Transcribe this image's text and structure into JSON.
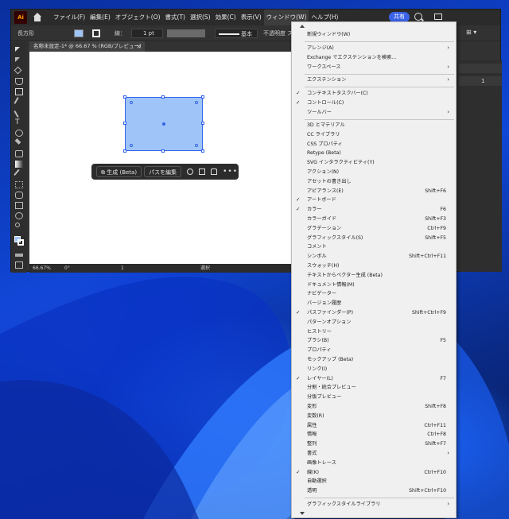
{
  "menubar": {
    "logo": "Ai",
    "items": [
      "ファイル(F)",
      "編集(E)",
      "オブジェクト(O)",
      "書式(T)",
      "選択(S)",
      "効果(C)",
      "表示(V)",
      "ウィンドウ(W)",
      "ヘルプ(H)"
    ],
    "active_item": "ウィンドウ(W)",
    "share_label": "共有"
  },
  "controlbar": {
    "object_type": "長方形",
    "stroke_label": "線：",
    "stroke_weight": "1 pt",
    "brush_label": "基本",
    "opacity_label": "不透明度 ス",
    "right_value": "1"
  },
  "document": {
    "tab_title": "名称未設定-1* @ 66.67 % (RGB/プレビュー)",
    "close_glyph": "×"
  },
  "context_bar": {
    "generate_label": "生成 (Beta)",
    "edit_path_label": "パスを編集",
    "more_glyph": "•••"
  },
  "statusbar": {
    "zoom": "66.67%",
    "rotation": "0°",
    "artboard": "1",
    "tool": "選択"
  },
  "colors": {
    "fill": "#9fc5f8",
    "selection": "#3563e8",
    "accent": "#3b63e6"
  },
  "window_menu": {
    "items": [
      {
        "label": "新規ウィンドウ(W)",
        "check": "",
        "shortcut": "",
        "submenu": false
      },
      {
        "label": "アレンジ(A)",
        "check": "",
        "shortcut": "",
        "submenu": true
      },
      {
        "label": "Exchange でエクステンションを検索...",
        "check": "",
        "shortcut": "",
        "submenu": false
      },
      {
        "label": "ワークスペース",
        "check": "",
        "shortcut": "",
        "submenu": true
      },
      {
        "label": "エクステンション",
        "check": "",
        "shortcut": "",
        "submenu": true
      },
      {
        "label": "コンテキストタスクバー(C)",
        "check": "✓",
        "shortcut": "",
        "submenu": false
      },
      {
        "label": "コントロール(C)",
        "check": "✓",
        "shortcut": "",
        "submenu": false
      },
      {
        "label": "ツールバー",
        "check": "",
        "shortcut": "",
        "submenu": true
      },
      {
        "label": "3D とマテリアル",
        "check": "",
        "shortcut": "",
        "submenu": false
      },
      {
        "label": "CC ライブラリ",
        "check": "",
        "shortcut": "",
        "submenu": false
      },
      {
        "label": "CSS プロパティ",
        "check": "",
        "shortcut": "",
        "submenu": false
      },
      {
        "label": "Retype (Beta)",
        "check": "",
        "shortcut": "",
        "submenu": false
      },
      {
        "label": "SVG インタラクティビティ(Y)",
        "check": "",
        "shortcut": "",
        "submenu": false
      },
      {
        "label": "アクション(N)",
        "check": "",
        "shortcut": "",
        "submenu": false
      },
      {
        "label": "アセットの書き出し",
        "check": "",
        "shortcut": "",
        "submenu": false
      },
      {
        "label": "アピアランス(E)",
        "check": "",
        "shortcut": "Shift+F6",
        "submenu": false
      },
      {
        "label": "アートボード",
        "check": "✓",
        "shortcut": "",
        "submenu": false
      },
      {
        "label": "カラー",
        "check": "✓",
        "shortcut": "F6",
        "submenu": false
      },
      {
        "label": "カラーガイド",
        "check": "",
        "shortcut": "Shift+F3",
        "submenu": false
      },
      {
        "label": "グラデーション",
        "check": "",
        "shortcut": "Ctrl+F9",
        "submenu": false
      },
      {
        "label": "グラフィックスタイル(S)",
        "check": "",
        "shortcut": "Shift+F5",
        "submenu": false
      },
      {
        "label": "コメント",
        "check": "",
        "shortcut": "",
        "submenu": false
      },
      {
        "label": "シンボル",
        "check": "",
        "shortcut": "Shift+Ctrl+F11",
        "submenu": false
      },
      {
        "label": "スウォッチ(H)",
        "check": "",
        "shortcut": "",
        "submenu": false
      },
      {
        "label": "テキストからベクター生成 (Beta)",
        "check": "",
        "shortcut": "",
        "submenu": false
      },
      {
        "label": "ドキュメント情報(M)",
        "check": "",
        "shortcut": "",
        "submenu": false
      },
      {
        "label": "ナビゲーター",
        "check": "",
        "shortcut": "",
        "submenu": false
      },
      {
        "label": "バージョン履歴",
        "check": "",
        "shortcut": "",
        "submenu": false
      },
      {
        "label": "パスファインダー(P)",
        "check": "✓",
        "shortcut": "Shift+Ctrl+F9",
        "submenu": false
      },
      {
        "label": "パターンオプション",
        "check": "",
        "shortcut": "",
        "submenu": false
      },
      {
        "label": "ヒストリー",
        "check": "",
        "shortcut": "",
        "submenu": false
      },
      {
        "label": "ブラシ(B)",
        "check": "",
        "shortcut": "F5",
        "submenu": false
      },
      {
        "label": "プロパティ",
        "check": "",
        "shortcut": "",
        "submenu": false
      },
      {
        "label": "モックアップ (Beta)",
        "check": "",
        "shortcut": "",
        "submenu": false
      },
      {
        "label": "リンク(I)",
        "check": "",
        "shortcut": "",
        "submenu": false
      },
      {
        "label": "レイヤー(L)",
        "check": "✓",
        "shortcut": "F7",
        "submenu": false
      },
      {
        "label": "分割・統合プレビュー",
        "check": "",
        "shortcut": "",
        "submenu": false
      },
      {
        "label": "分版プレビュー",
        "check": "",
        "shortcut": "",
        "submenu": false
      },
      {
        "label": "変形",
        "check": "",
        "shortcut": "Shift+F8",
        "submenu": false
      },
      {
        "label": "変数(R)",
        "check": "",
        "shortcut": "",
        "submenu": false
      },
      {
        "label": "属性",
        "check": "",
        "shortcut": "Ctrl+F11",
        "submenu": false
      },
      {
        "label": "情報",
        "check": "",
        "shortcut": "Ctrl+F8",
        "submenu": false
      },
      {
        "label": "整列",
        "check": "",
        "shortcut": "Shift+F7",
        "submenu": false
      },
      {
        "label": "書式",
        "check": "",
        "shortcut": "",
        "submenu": true
      },
      {
        "label": "画像トレース",
        "check": "",
        "shortcut": "",
        "submenu": false
      },
      {
        "label": "線(K)",
        "check": "✓",
        "shortcut": "Ctrl+F10",
        "submenu": false
      },
      {
        "label": "自動選択",
        "check": "",
        "shortcut": "",
        "submenu": false
      },
      {
        "label": "透明",
        "check": "",
        "shortcut": "Shift+Ctrl+F10",
        "submenu": false
      },
      {
        "label": "グラフィックスタイルライブラリ",
        "check": "",
        "shortcut": "",
        "submenu": true
      }
    ]
  }
}
